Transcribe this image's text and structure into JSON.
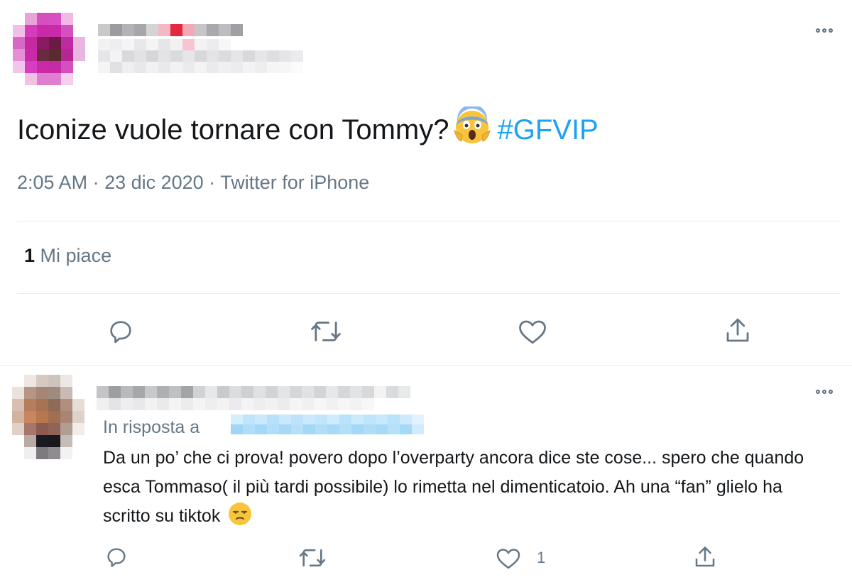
{
  "colors": {
    "text": "#14171a",
    "secondary": "#657786",
    "link": "#1da1f2",
    "divider": "#e6ecf0"
  },
  "main_tweet": {
    "avatar_icon": "pixelated-avatar",
    "text": "Iconize vuole tornare con Tommy?",
    "emoji": "face-screaming-in-fear",
    "hashtag": "#GFVIP",
    "time": "2:05 AM",
    "date": "23 dic 2020",
    "source": "Twitter for iPhone",
    "like_count": "1",
    "like_label": "Mi piace",
    "actions": [
      "reply-icon",
      "retweet-icon",
      "like-icon",
      "share-icon"
    ]
  },
  "reply_tweet": {
    "avatar_icon": "pixelated-avatar",
    "reply_to_label": "In risposta a",
    "text": "Da un po’ che ci prova! povero dopo l’overparty ancora dice ste cose... spero che quando esca Tommaso( il più tardi possibile) lo rimetta nel dimenticatoio. Ah una “fan” glielo ha scritto su tiktok",
    "emoji": "unamused-face",
    "like_count": "1",
    "actions": [
      "reply-icon",
      "retweet-icon",
      "like-icon",
      "share-icon"
    ]
  }
}
